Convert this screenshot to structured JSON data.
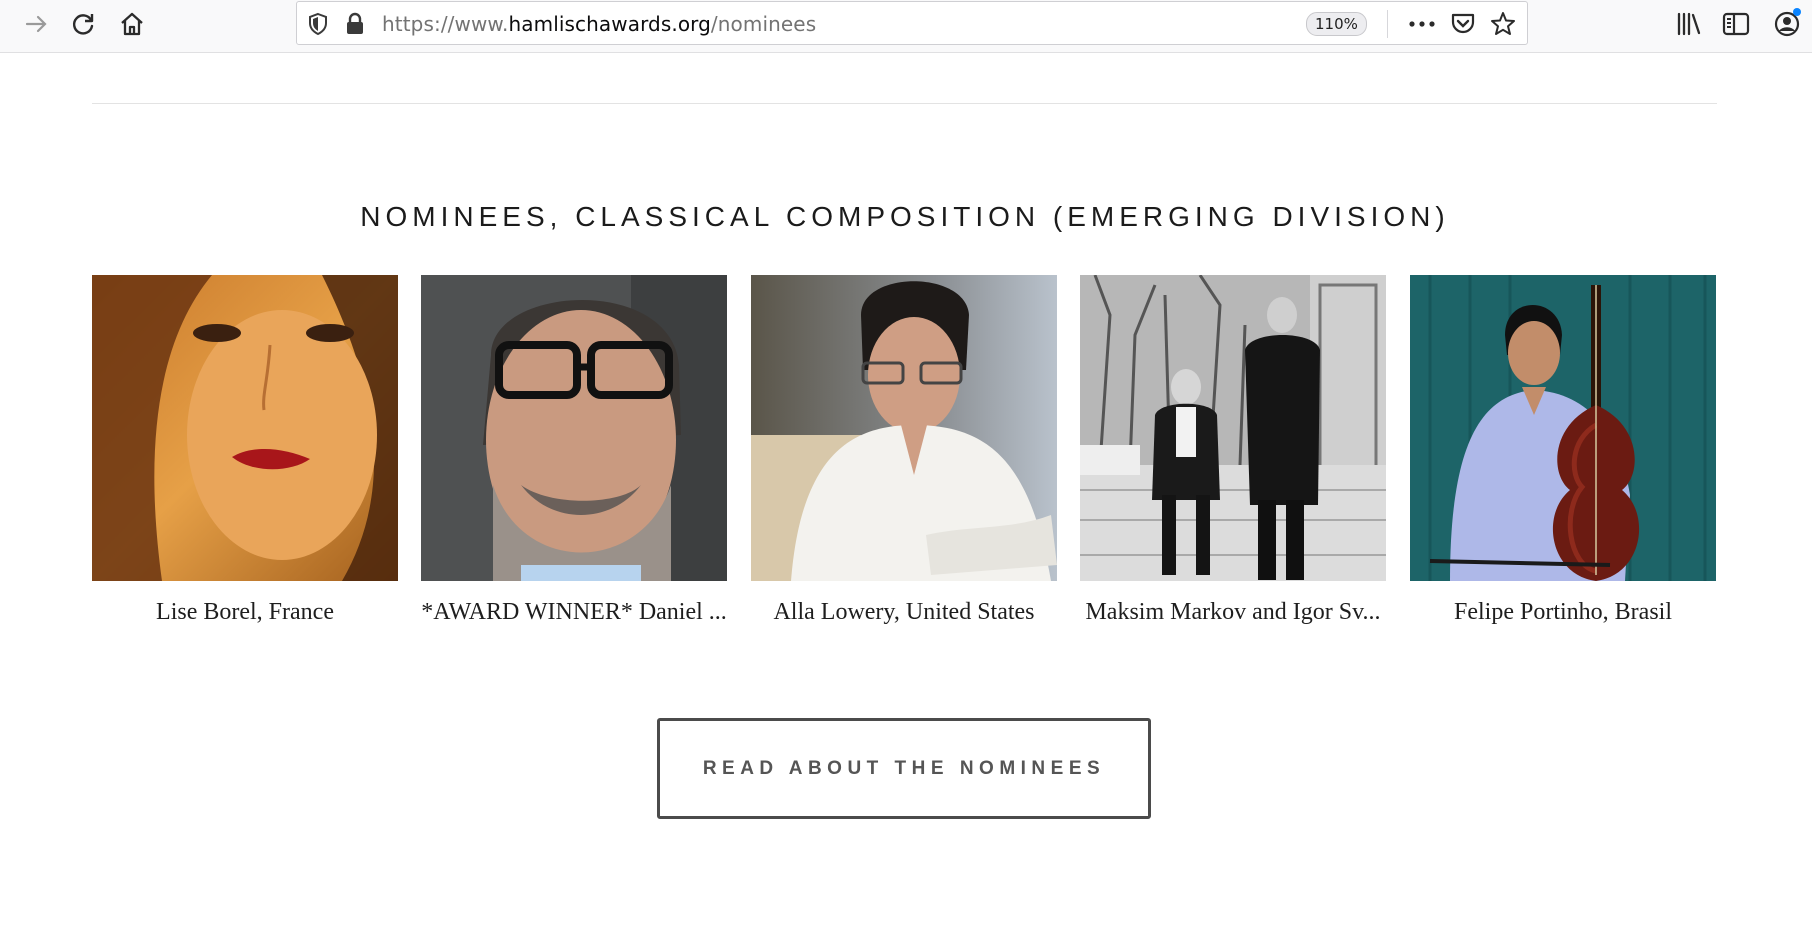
{
  "browser": {
    "url_scheme": "https://www.",
    "url_domain": "hamlischawards.org",
    "url_path": "/nominees",
    "zoom": "110%",
    "icons": [
      "back-arrow-icon",
      "forward-arrow-icon",
      "reload-icon",
      "home-icon",
      "tracking-shield-icon",
      "lock-icon",
      "more-dots-icon",
      "pocket-icon",
      "bookmark-star-icon",
      "library-icon",
      "sidebar-icon",
      "account-icon"
    ],
    "notification_color": "#0a84ff"
  },
  "section": {
    "title": "NOMINEES, CLASSICAL COMPOSITION (EMERGING DIVISION)"
  },
  "nominees": [
    {
      "name": "Lise Borel, France"
    },
    {
      "name": "*AWARD WINNER* Daniel ..."
    },
    {
      "name": "Alla Lowery, United States"
    },
    {
      "name": "Maksim Markov and Igor Sv..."
    },
    {
      "name": "Felipe Portinho, Brasil"
    }
  ],
  "cta": {
    "label": "READ ABOUT THE NOMINEES",
    "border_color": "#4b4b4b"
  }
}
